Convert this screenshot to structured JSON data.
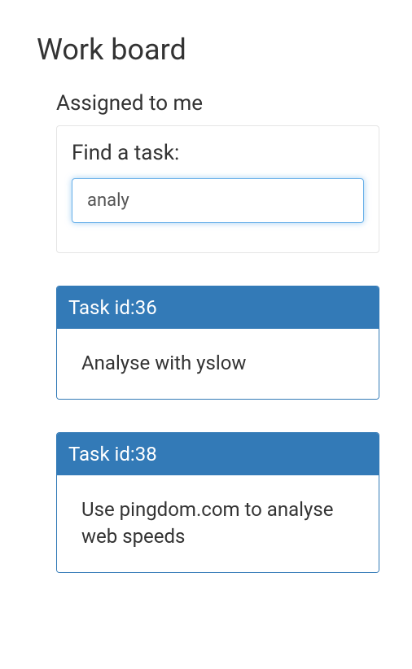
{
  "page": {
    "title": "Work board"
  },
  "section": {
    "title": "Assigned to me"
  },
  "search": {
    "label": "Find a task:",
    "value": "analy"
  },
  "tasks": [
    {
      "header": "Task id:36",
      "body": "Analyse with yslow"
    },
    {
      "header": "Task id:38",
      "body": "Use pingdom.com to analyse web speeds"
    }
  ]
}
